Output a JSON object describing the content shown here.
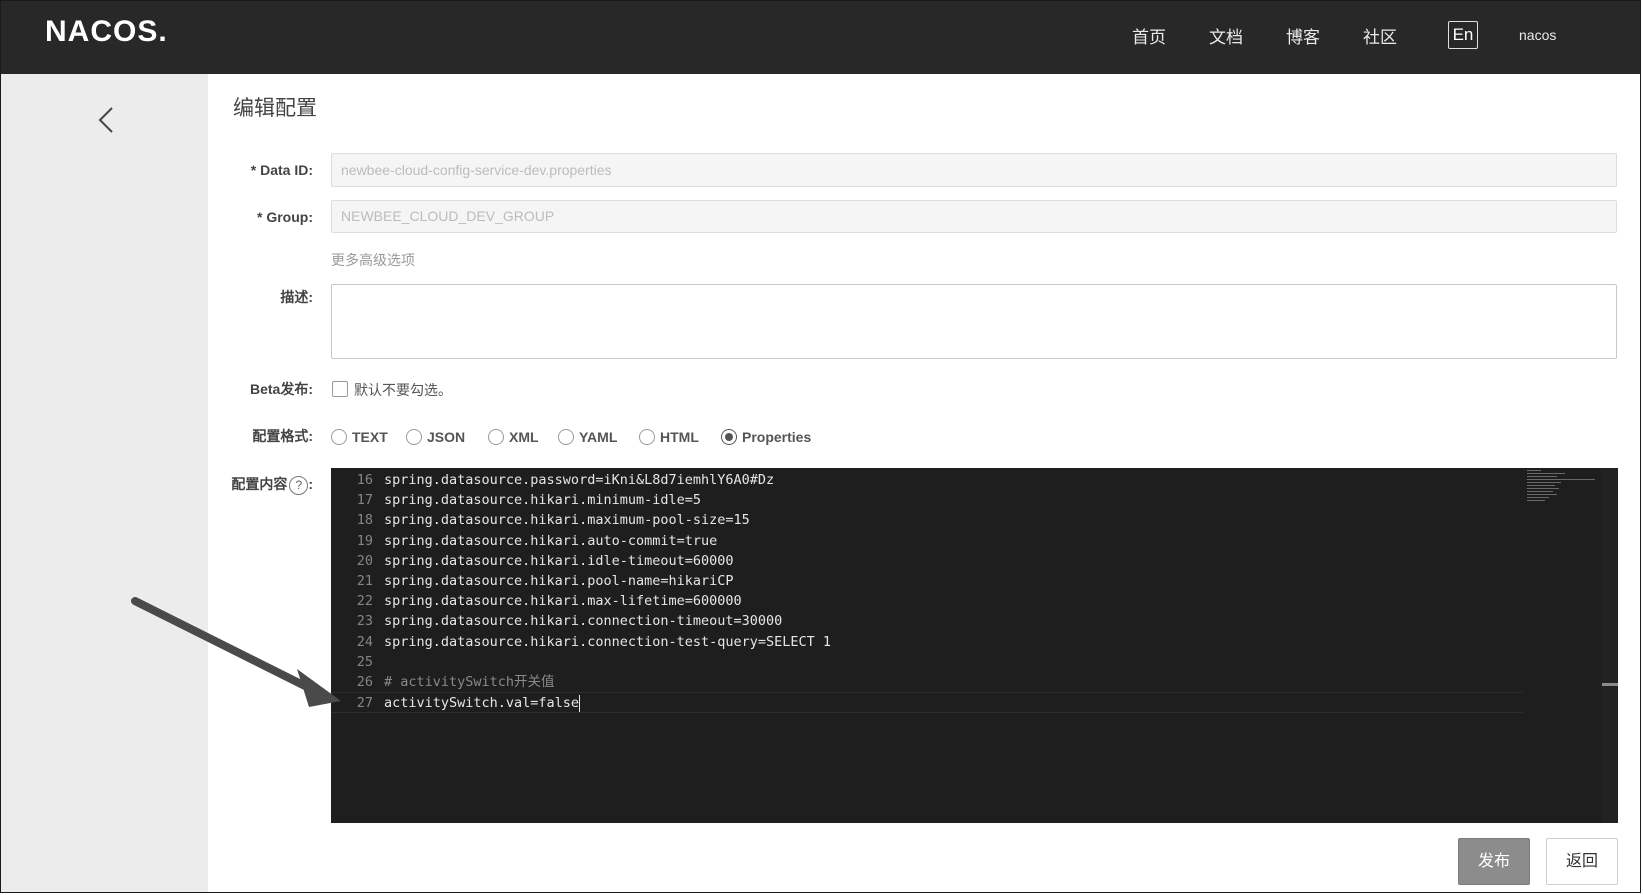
{
  "header": {
    "logo": "NACOS.",
    "nav": [
      "首页",
      "文档",
      "博客",
      "社区"
    ],
    "lang": "En",
    "user": "nacos"
  },
  "page": {
    "title": "编辑配置",
    "data_id_label": "* Data ID:",
    "data_id_value": "newbee-cloud-config-service-dev.properties",
    "group_label": "* Group:",
    "group_value": "NEWBEE_CLOUD_DEV_GROUP",
    "advanced_link": "更多高级选项",
    "desc_label": "描述:",
    "beta_label": "Beta发布:",
    "beta_hint": "默认不要勾选。",
    "format_label": "配置格式:",
    "formats": [
      "TEXT",
      "JSON",
      "XML",
      "YAML",
      "HTML",
      "Properties"
    ],
    "selected_format": "Properties",
    "content_label": "配置内容",
    "content_colon": ":",
    "help_glyph": "?"
  },
  "editor": {
    "lines": [
      {
        "n": "16",
        "t": "spring.datasource.password=iKni&L8d7iemhlY6A0#Dz"
      },
      {
        "n": "17",
        "t": "spring.datasource.hikari.minimum-idle=5"
      },
      {
        "n": "18",
        "t": "spring.datasource.hikari.maximum-pool-size=15"
      },
      {
        "n": "19",
        "t": "spring.datasource.hikari.auto-commit=true"
      },
      {
        "n": "20",
        "t": "spring.datasource.hikari.idle-timeout=60000"
      },
      {
        "n": "21",
        "t": "spring.datasource.hikari.pool-name=hikariCP"
      },
      {
        "n": "22",
        "t": "spring.datasource.hikari.max-lifetime=600000"
      },
      {
        "n": "23",
        "t": "spring.datasource.hikari.connection-timeout=30000"
      },
      {
        "n": "24",
        "t": "spring.datasource.hikari.connection-test-query=SELECT 1"
      },
      {
        "n": "25",
        "t": ""
      },
      {
        "n": "26",
        "t": "# activitySwitch开关值"
      },
      {
        "n": "27",
        "t": "activitySwitch.val=false"
      }
    ]
  },
  "actions": {
    "publish": "发布",
    "back": "返回"
  },
  "colors": {
    "topbar": "#282828",
    "sidebar": "#ececec",
    "editor_bg": "#1e1e1e",
    "primary_button": "#8c8c8c"
  }
}
